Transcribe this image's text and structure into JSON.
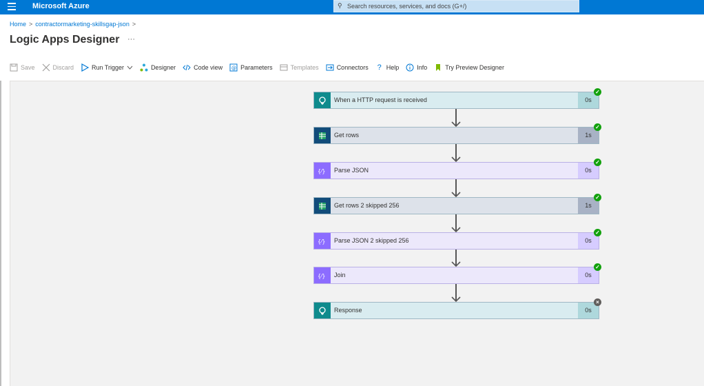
{
  "topbar": {
    "brand": "Microsoft Azure",
    "search_placeholder": "Search resources, services, and docs (G+/)"
  },
  "breadcrumb": {
    "home": "Home",
    "resource": "contractormarketing-skillsgap-json"
  },
  "page": {
    "title": "Logic Apps Designer",
    "more": "···"
  },
  "toolbar": {
    "save": "Save",
    "discard": "Discard",
    "run_trigger": "Run Trigger",
    "designer": "Designer",
    "code_view": "Code view",
    "parameters": "Parameters",
    "templates": "Templates",
    "connectors": "Connectors",
    "help": "Help",
    "info": "Info",
    "try_preview": "Try Preview Designer"
  },
  "steps": [
    {
      "label": "When a HTTP request is received",
      "duration": "0s",
      "status": "succeeded",
      "kind": "http"
    },
    {
      "label": "Get rows",
      "duration": "1s",
      "status": "succeeded",
      "kind": "sheet"
    },
    {
      "label": "Parse JSON",
      "duration": "0s",
      "status": "succeeded",
      "kind": "parse"
    },
    {
      "label": "Get rows 2 skipped 256",
      "duration": "1s",
      "status": "succeeded",
      "kind": "sheet"
    },
    {
      "label": "Parse JSON 2 skipped 256",
      "duration": "0s",
      "status": "succeeded",
      "kind": "parse"
    },
    {
      "label": "Join",
      "duration": "0s",
      "status": "succeeded",
      "kind": "parse"
    },
    {
      "label": "Response",
      "duration": "0s",
      "status": "failed",
      "kind": "http"
    }
  ],
  "colors": {
    "azure_blue": "#0078d4",
    "success": "#13a10e"
  }
}
